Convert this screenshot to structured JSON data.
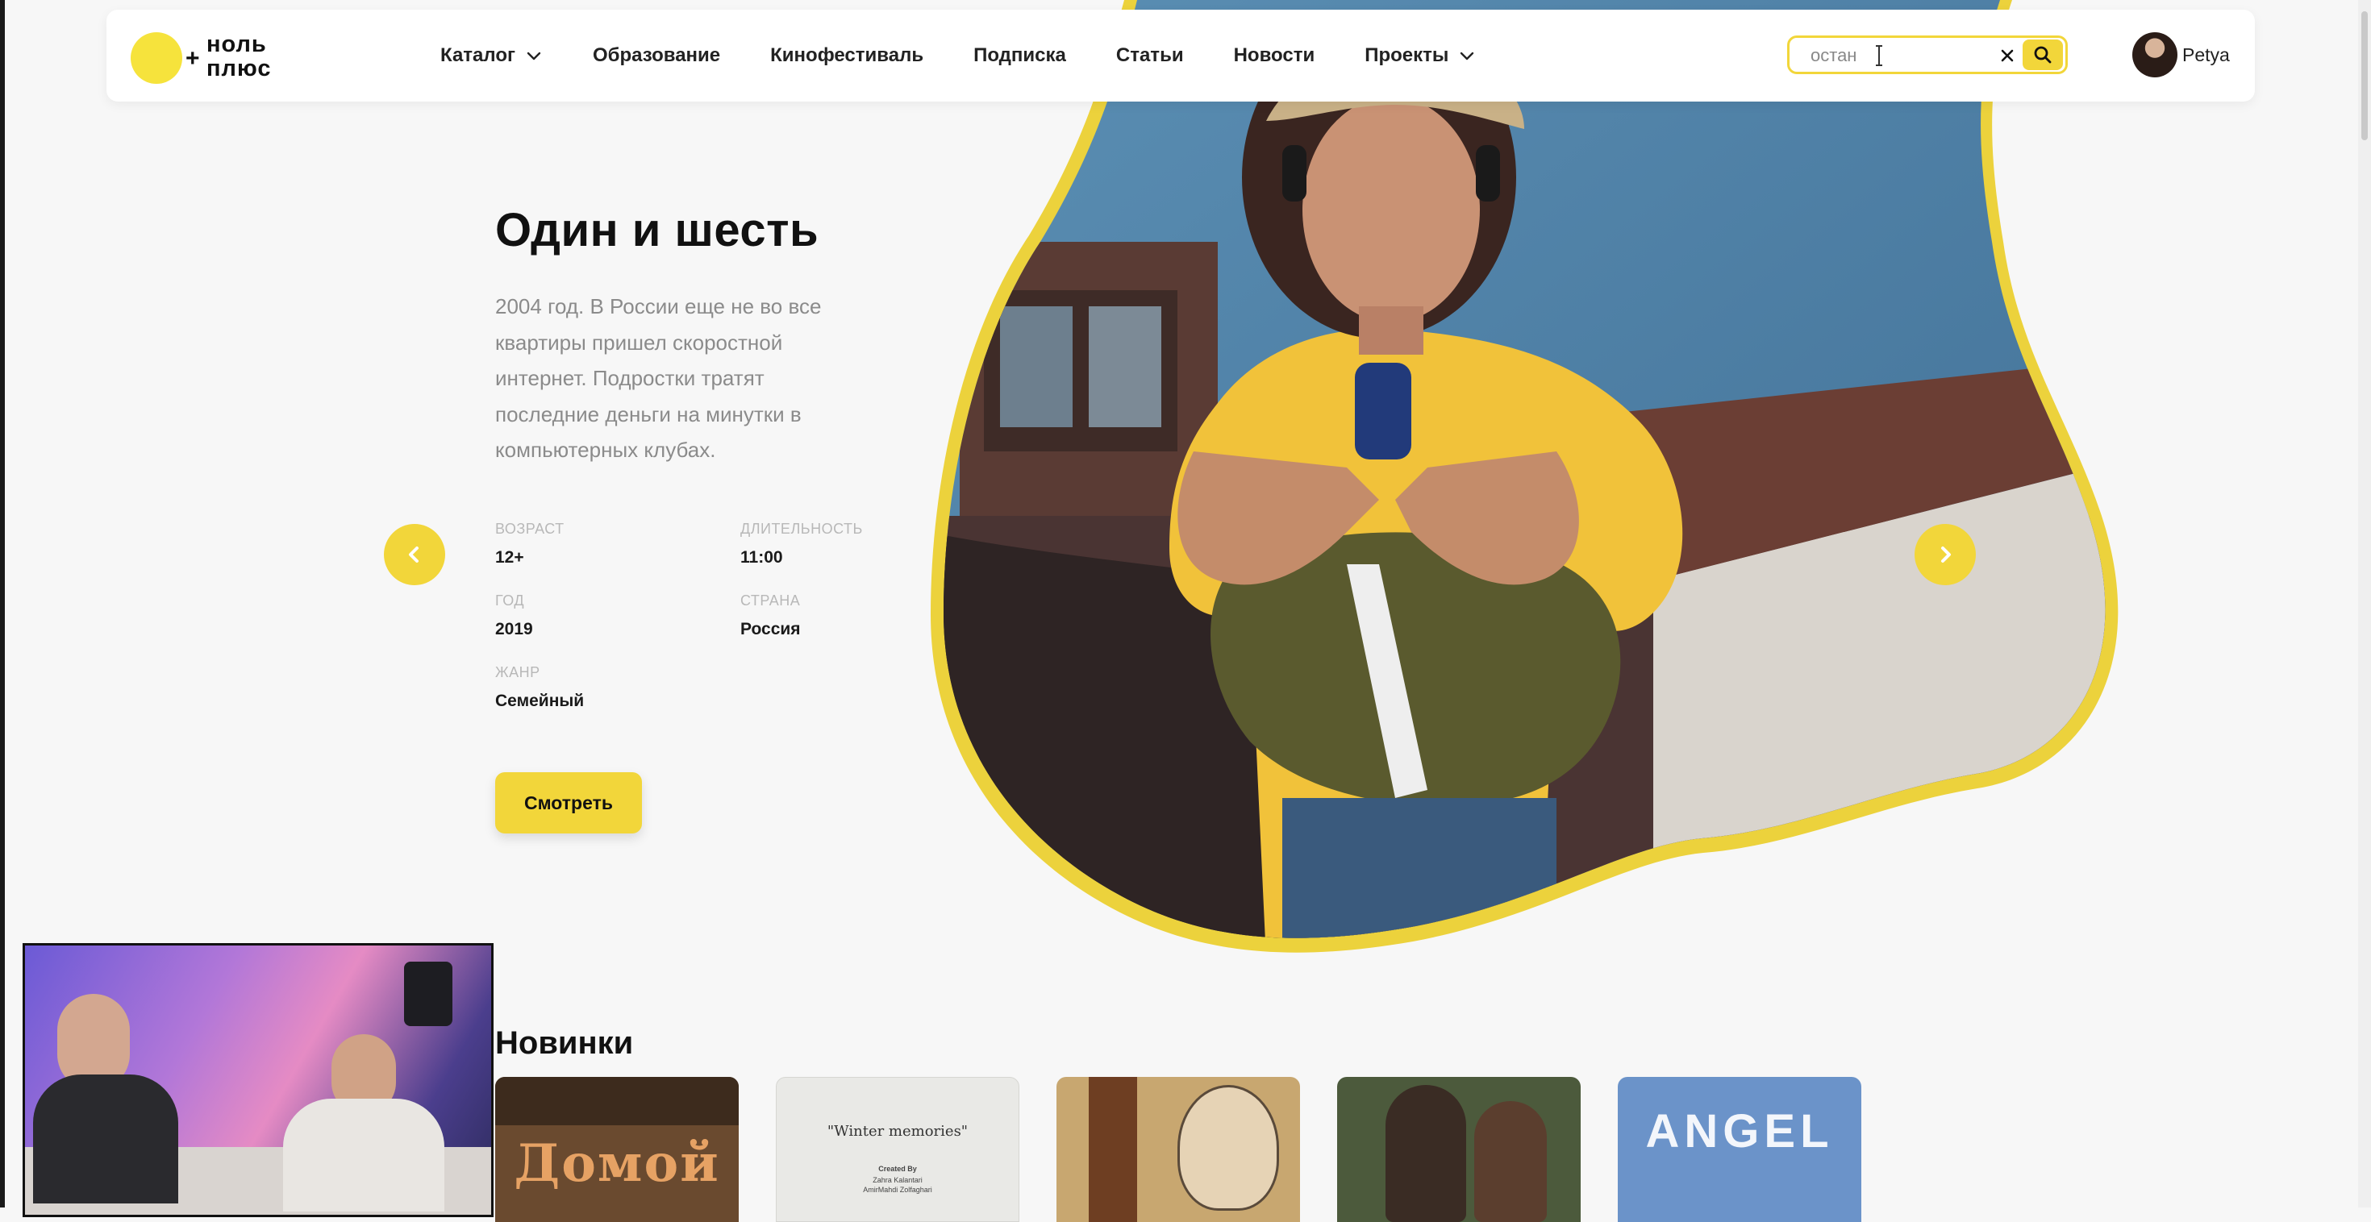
{
  "header": {
    "logo": {
      "plus": "+",
      "line1": "ноль",
      "line2": "плюс"
    },
    "nav": [
      {
        "label": "Каталог",
        "has_dropdown": true
      },
      {
        "label": "Образование",
        "has_dropdown": false
      },
      {
        "label": "Кинофестиваль",
        "has_dropdown": false
      },
      {
        "label": "Подписка",
        "has_dropdown": false
      },
      {
        "label": "Статьи",
        "has_dropdown": false
      },
      {
        "label": "Новости",
        "has_dropdown": false
      },
      {
        "label": "Проекты",
        "has_dropdown": true
      }
    ],
    "search": {
      "value": "остан",
      "clear_icon": "close-icon",
      "submit_icon": "search-icon"
    },
    "user": {
      "name": "Petya"
    }
  },
  "hero": {
    "title": "Один и шесть",
    "description": "2004 год. В России еще не во все квартиры пришел скоростной интернет. Подростки тратят последние деньги на минутки в компьютерных клубах.",
    "meta": {
      "age": {
        "label": "Возраст",
        "value": "12+"
      },
      "duration": {
        "label": "Длительность",
        "value": "11:00"
      },
      "year": {
        "label": "Год",
        "value": "2019"
      },
      "country": {
        "label": "Страна",
        "value": "Россия"
      },
      "genre": {
        "label": "Жанр",
        "value": "Семейный"
      }
    },
    "watch_label": "Смотреть",
    "prev_icon": "chevron-left-icon",
    "next_icon": "chevron-right-icon"
  },
  "new_section": {
    "title": "Новинки",
    "cards": [
      {
        "art_text": "Домой"
      },
      {
        "art_text": "\"Winter memories\"",
        "art_sub": "Created By",
        "art_sub2": "Zahra Kalantari",
        "art_sub3": "AmirMahdi Zolfaghari"
      },
      {
        "art_text": ""
      },
      {
        "art_text": ""
      },
      {
        "art_text": "ANGEL"
      }
    ]
  },
  "colors": {
    "accent": "#f2d63a",
    "background": "#f7f7f7",
    "text": "#111111",
    "muted": "#8b8b8b"
  }
}
